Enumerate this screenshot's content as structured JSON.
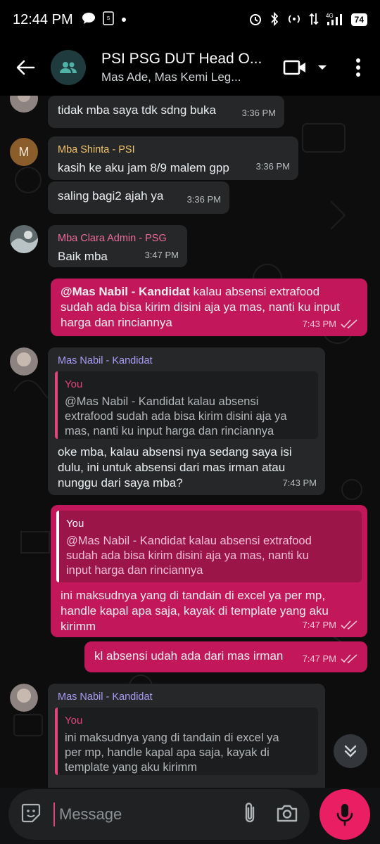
{
  "statusbar": {
    "time": "12:44 PM",
    "battery": "74",
    "network": "4G"
  },
  "header": {
    "title": "PSI PSG DUT Head O...",
    "subtitle": "Mas Ade, Mas Kemi Leg..."
  },
  "messages": [
    {
      "id": "m1",
      "text": "tidak mba saya tdk sdng buka",
      "time": "3:36 PM"
    },
    {
      "id": "m2",
      "sender": "Mba Shinta - PSI",
      "avatar_letter": "M",
      "text": "kasih ke aku jam 8/9 malem gpp",
      "time": "3:36 PM"
    },
    {
      "id": "m3",
      "text": "saling bagi2 ajah ya",
      "time": "3:36 PM"
    },
    {
      "id": "m4",
      "sender": "Mba Clara Admin - PSG",
      "text": "Baik mba",
      "time": "3:47 PM"
    },
    {
      "id": "m5",
      "mention": "@Mas Nabil - Kandidat",
      "text_line1": " kalau absensi extrafood",
      "text_line2": "sudah ada bisa kirim disini aja ya mas, nanti ku input",
      "text_line3": "harga dan rinciannya",
      "time": "7:43 PM"
    },
    {
      "id": "m6",
      "sender": "Mas Nabil - Kandidat",
      "quote_name": "You",
      "quote_lines": [
        "@Mas Nabil - Kandidat kalau absensi",
        "extrafood sudah ada bisa kirim disini aja ya",
        "mas, nanti ku input harga dan rinciannya"
      ],
      "lines": [
        "oke mba, kalau absensi nya sedang saya isi",
        "dulu, ini untuk absensi dari mas irman atau",
        "nunggu dari saya mba?"
      ],
      "time": "7:43 PM"
    },
    {
      "id": "m7",
      "quote_name": "You",
      "quote_lines": [
        "@Mas Nabil - Kandidat kalau absensi extrafood",
        "sudah ada bisa kirim disini aja ya mas, nanti ku",
        "input harga dan rinciannya"
      ],
      "lines": [
        "ini maksudnya yang di tandain di excel ya per mp,",
        "handle kapal apa saja, kayak di template yang aku",
        "kirimm"
      ],
      "time": "7:47 PM"
    },
    {
      "id": "m8",
      "text": "kl absensi udah ada dari mas irman",
      "time": "7:47 PM"
    },
    {
      "id": "m9",
      "sender": "Mas Nabil - Kandidat",
      "quote_name": "You",
      "quote_lines": [
        "ini maksudnya yang di tandain di excel ya",
        "per mp, handle kapal apa saja, kayak di",
        "template yang aku kirimm"
      ]
    }
  ],
  "input": {
    "placeholder": "Message"
  },
  "colors": {
    "accent": "#e91e63",
    "outgoing": "#c2185b",
    "incoming": "#262729"
  }
}
